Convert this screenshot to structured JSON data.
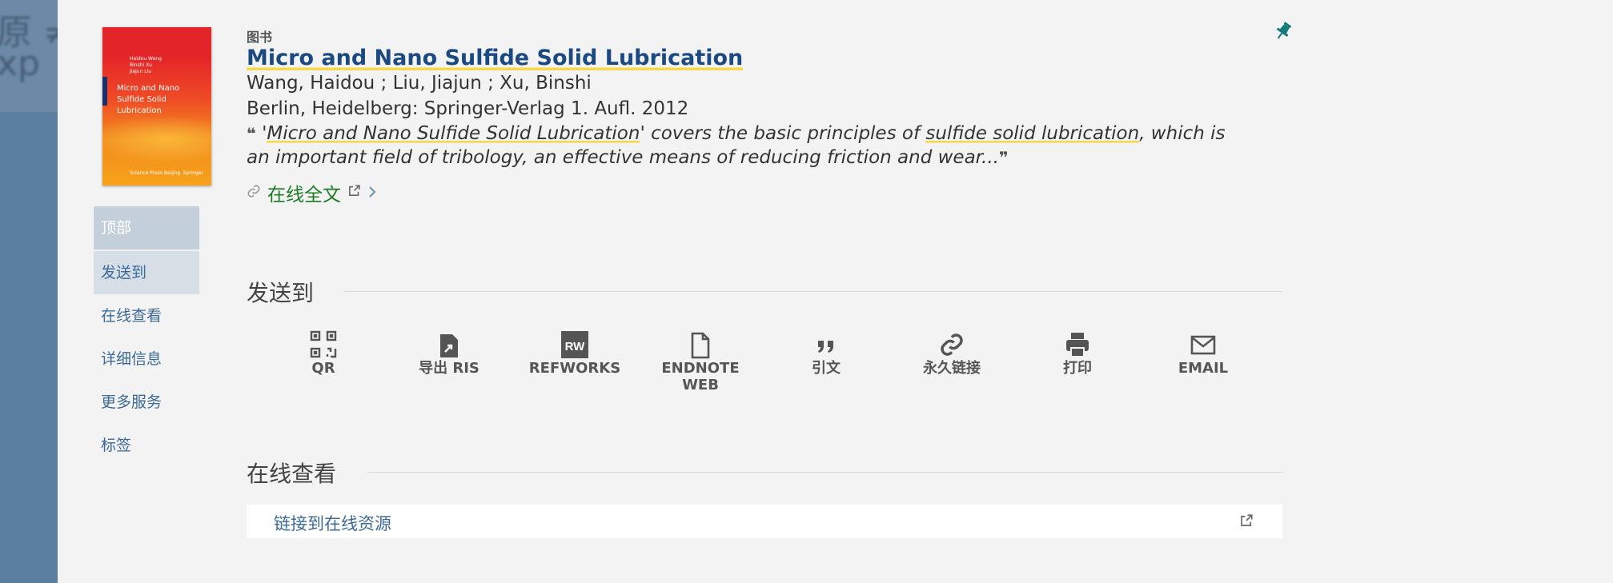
{
  "backdrop": {
    "ghost_line1": "原 ≠",
    "ghost_line2": "xp"
  },
  "cover": {
    "authors": [
      "Haidou Wang",
      "Binshi Xu",
      "Jiajun Liu"
    ],
    "title": "Micro and Nano Sulfide Solid Lubrication",
    "publisher": "Science Press Beijing",
    "publisher2": "Springer"
  },
  "sidenav": {
    "items": [
      {
        "label": "顶部"
      },
      {
        "label": "发送到"
      },
      {
        "label": "在线查看"
      },
      {
        "label": "详细信息"
      },
      {
        "label": "更多服务"
      },
      {
        "label": "标签"
      }
    ]
  },
  "record": {
    "type": "图书",
    "title": "Micro and Nano Sulfide Solid Lubrication",
    "authors": "Wang, Haidou ; Liu, Jiajun ; Xu, Binshi",
    "publication": "Berlin, Heidelberg: Springer-Verlag 1. Aufl. 2012",
    "abstract_open_quote": "❝",
    "abstract_part1": "'",
    "abstract_hl1": "Micro and Nano Sulfide Solid Lubrication",
    "abstract_part2": "' covers the basic principles of ",
    "abstract_hl2": "sulfide solid lubrication",
    "abstract_part3": ", which is an important field of tribology, an effective means of reducing friction and wear...",
    "abstract_close_quote": "❞",
    "fulltext_label": "在线全文"
  },
  "send_to": {
    "heading": "发送到",
    "actions": [
      {
        "label": "QR",
        "icon": "qr-code-icon"
      },
      {
        "label": "导出 RIS",
        "icon": "export-file-icon"
      },
      {
        "label": "REFWORKS",
        "icon": "refworks-icon",
        "icon_text": "RW"
      },
      {
        "label": "ENDNOTE WEB",
        "icon": "file-icon"
      },
      {
        "label": "引文",
        "icon": "quote-icon"
      },
      {
        "label": "永久链接",
        "icon": "link-icon"
      },
      {
        "label": "打印",
        "icon": "print-icon"
      },
      {
        "label": "EMAIL",
        "icon": "mail-icon"
      }
    ]
  },
  "online_view": {
    "heading": "在线查看",
    "link_label": "链接到在线资源"
  },
  "colors": {
    "accent": "#1b4a83",
    "link": "#3c6a9b",
    "fulltext_green": "#1c7a27",
    "highlight": "#f5d94a",
    "pin": "#177a7a"
  }
}
